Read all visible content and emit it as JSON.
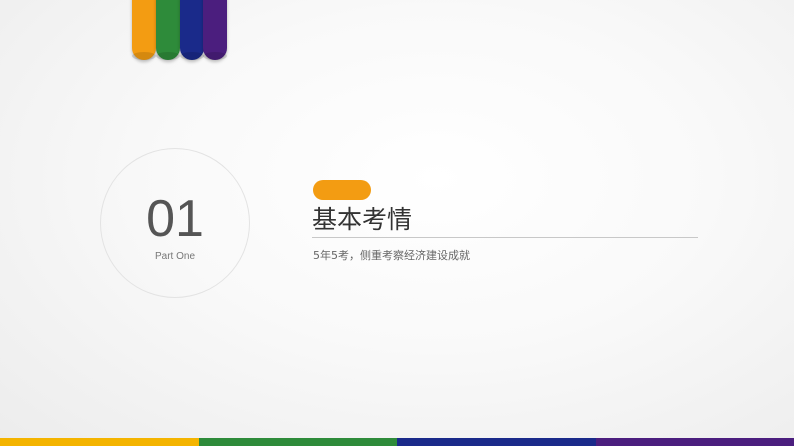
{
  "colors": {
    "orange": "#F39C12",
    "green": "#2E8B3A",
    "blue": "#1A2A8A",
    "purple": "#4B1E7E",
    "yellow": "#F4B400"
  },
  "section": {
    "number": "01",
    "part_label": "Part One",
    "title": "基本考情",
    "subtitle": "5年5考，侧重考察经济建设成就"
  }
}
